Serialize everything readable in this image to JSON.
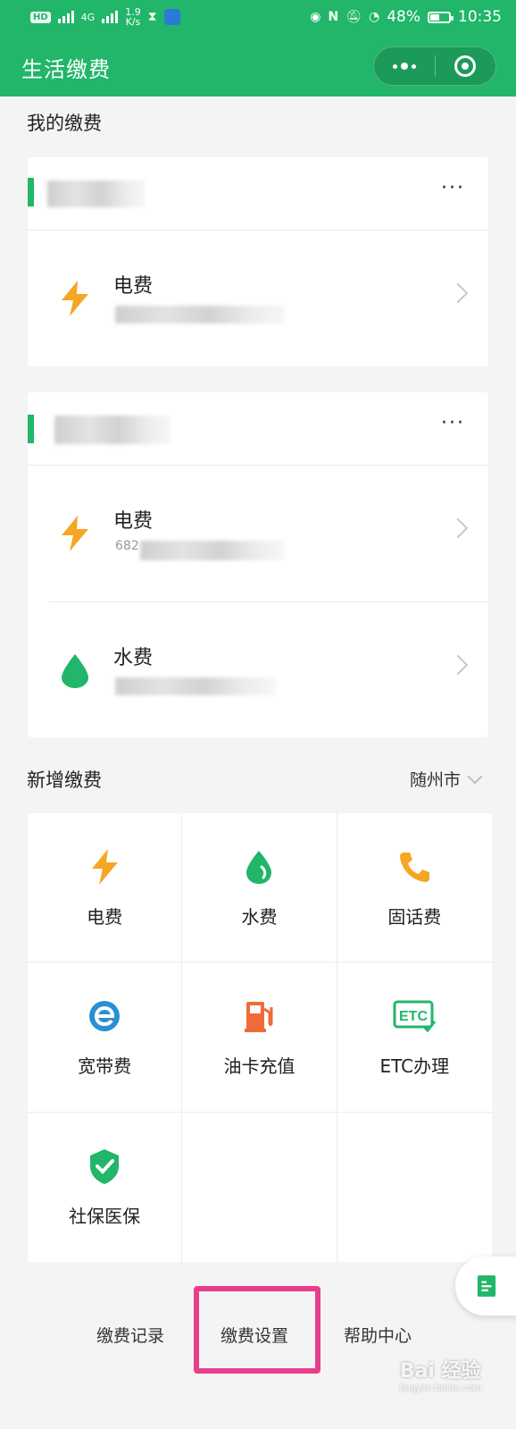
{
  "status_bar": {
    "hd_badge": "HD",
    "network": "4G",
    "speed_value": "1.9",
    "speed_unit": "K/s",
    "battery": "48%",
    "battery_level": 0.48,
    "time": "10:35"
  },
  "header": {
    "title": "生活缴费"
  },
  "my_payments": {
    "section_title": "我的缴费",
    "groups": [
      {
        "rows": [
          {
            "title": "电费",
            "icon": "lightning-icon"
          }
        ]
      },
      {
        "rows": [
          {
            "title": "电费",
            "icon": "lightning-icon",
            "visible_number": "682"
          },
          {
            "title": "水费",
            "icon": "water-drop-icon"
          }
        ]
      }
    ]
  },
  "new_payment": {
    "section_title": "新增缴费",
    "city": "随州市",
    "items": [
      {
        "label": "电费",
        "icon": "lightning-icon"
      },
      {
        "label": "水费",
        "icon": "water-drop-icon"
      },
      {
        "label": "固话费",
        "icon": "phone-icon"
      },
      {
        "label": "宽带费",
        "icon": "broadband-e-icon"
      },
      {
        "label": "油卡充值",
        "icon": "fuel-pump-icon"
      },
      {
        "label": "ETC办理",
        "icon": "etc-icon"
      },
      {
        "label": "社保医保",
        "icon": "shield-check-icon"
      }
    ]
  },
  "etc_icon_text": "ETC",
  "bottom_nav": {
    "records": "缴费记录",
    "settings": "缴费设置",
    "help": "帮助中心"
  },
  "watermark": {
    "brand": "Bai 经验",
    "url": "jingyan.baidu.com"
  },
  "colors": {
    "brand_green": "#21b66a",
    "lightning": "#f5a623",
    "water": "#21b66a",
    "phone": "#f5a623",
    "broadband": "#2b8fd6",
    "fuel": "#f06b3a",
    "etc": "#21b66a",
    "shield": "#21b66a",
    "highlight": "#e83e8c"
  }
}
